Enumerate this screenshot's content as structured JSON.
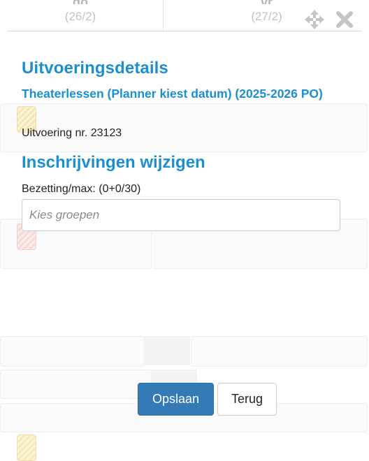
{
  "calendar": {
    "days": [
      {
        "name": "do",
        "date": "(26/2)"
      },
      {
        "name": "vr",
        "date": "(27/2)"
      }
    ]
  },
  "toolbar": {
    "move_icon": "move-icon",
    "close_icon": "close-icon"
  },
  "details": {
    "heading": "Uitvoeringsdetails",
    "activity": "Theaterlessen (Planner kiest datum) (2025-2026 PO)",
    "performance": "Uitvoering nr. 23123"
  },
  "registrations": {
    "heading": "Inschrijvingen wijzigen",
    "occupancy": "Bezetting/max: (0+0/30)",
    "groups_placeholder": "Kies groepen",
    "groups_value": ""
  },
  "actions": {
    "save_label": "Opslaan",
    "back_label": "Terug"
  },
  "colors": {
    "heading": "#1b8fcf",
    "primary_button": "#337ab7"
  }
}
